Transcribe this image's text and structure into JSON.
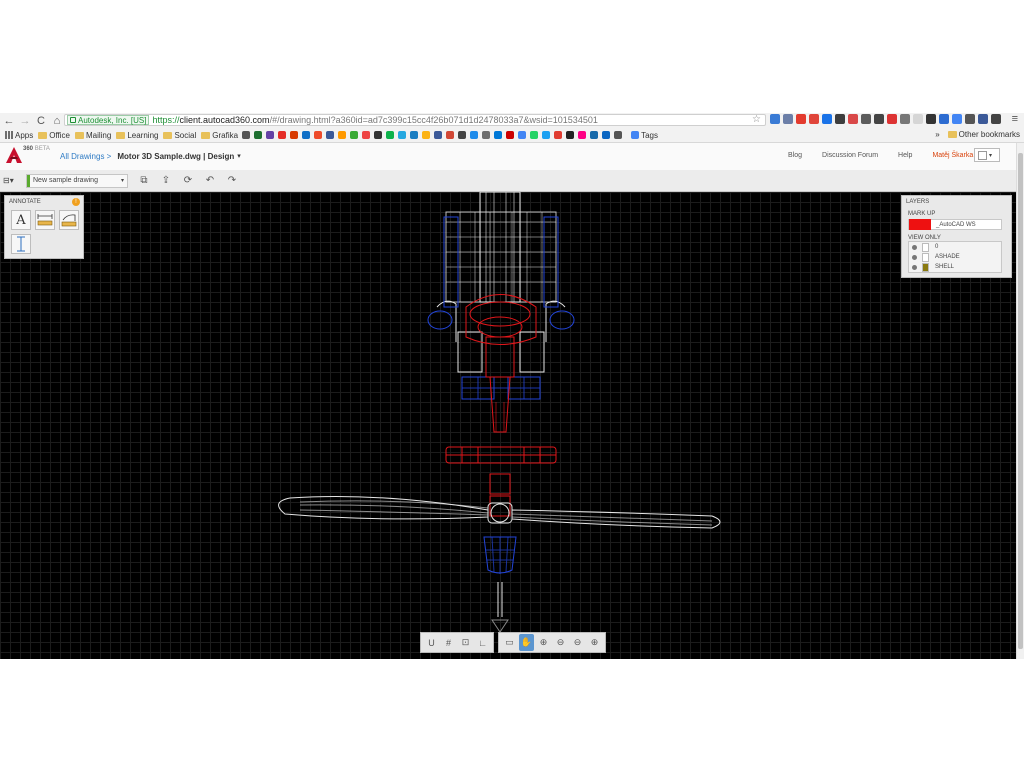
{
  "browser": {
    "nav": {
      "back": "←",
      "forward": "→",
      "reload": "C",
      "home": "⌂"
    },
    "ev_badge": "Autodesk, Inc. [US]",
    "url_scheme": "https://",
    "url_host": "client.autocad360.com",
    "url_rest": "/#/drawing.html?a360id=ad7c399c15cc4f26b071d1d2478033a7&wsid=101534501",
    "star": "☆",
    "menu": "≡",
    "extension_colors": [
      "#3a7bd5",
      "#6c7fa8",
      "#e33b2e",
      "#e0453a",
      "#1a73e8",
      "#3d3d3d",
      "#d94848",
      "#5c5c5c",
      "#444",
      "#d33",
      "#777",
      "#d6d6d6",
      "#333",
      "#2d6cd1",
      "#4285f4",
      "#555",
      "#3b5998",
      "#444"
    ],
    "bookmarks": {
      "apps": "Apps",
      "folders": [
        "Office",
        "Mailing",
        "Learning",
        "Social",
        "Grafika"
      ],
      "icon_colors": [
        "#555",
        "#1d6e2f",
        "#6441a5",
        "#e52d27",
        "#d83b01",
        "#0f6fc6",
        "#ee4b2b",
        "#3b5998",
        "#ff9900",
        "#3aaa35",
        "#e44",
        "#333",
        "#0db14b",
        "#26a8e0",
        "#1b7ec2",
        "#fcb315",
        "#3b5998",
        "#d14836",
        "#444",
        "#1f8ceb",
        "#6d6d6d",
        "#0078d7",
        "#cc0000",
        "#4285f4",
        "#25d366",
        "#1da1f2",
        "#e03c31",
        "#222",
        "#ff0084",
        "#1769aa",
        "#0a66c2",
        "#555"
      ],
      "tags_label": "Tags",
      "more": "»",
      "other": "Other bookmarks"
    }
  },
  "app": {
    "logo_number": "360",
    "logo_beta": "BETA",
    "breadcrumb_link": "All Drawings >",
    "breadcrumb_current": "Motor 3D Sample.dwg | Design",
    "breadcrumb_caret": "▾",
    "links": {
      "blog": "Blog",
      "forum": "Discussion Forum",
      "help": "Help"
    },
    "user": "Matěj Škarka",
    "color_caret": "▾"
  },
  "toolbar": {
    "open_icon": "⊟▾",
    "drawing_name": "New sample drawing",
    "select_caret": "▾",
    "buttons": {
      "b1": "⧉",
      "b2": "⇪",
      "b3": "⟳",
      "undo": "↶",
      "redo": "↷"
    }
  },
  "annotate": {
    "title": "ANNOTATE",
    "info": "!",
    "text_tool": "A"
  },
  "layers": {
    "title": "LAYERS",
    "markup_label": "MARK UP",
    "markup_layer": "_AutoCAD WS",
    "markup_color": "#ee1111",
    "view_only_label": "VIEW ONLY",
    "items": [
      {
        "name": "0",
        "color": "#ffffff"
      },
      {
        "name": "ASHADE",
        "color": "#ffffff"
      },
      {
        "name": "SHELL",
        "color": "#8a7a10"
      }
    ]
  },
  "bottom_toolbar": {
    "group1": [
      "U",
      "#",
      "⊡",
      "∟"
    ],
    "group2": [
      "▭",
      "✋",
      "⊕",
      "⊖",
      "⊖",
      "⊕"
    ]
  },
  "colors": {
    "canvas_bg": "#000000",
    "wire_white": "#e6e6e6",
    "wire_red": "#e0161a",
    "wire_blue": "#2244d8",
    "link_blue": "#2e7bc4",
    "user_orange": "#d9420b"
  }
}
